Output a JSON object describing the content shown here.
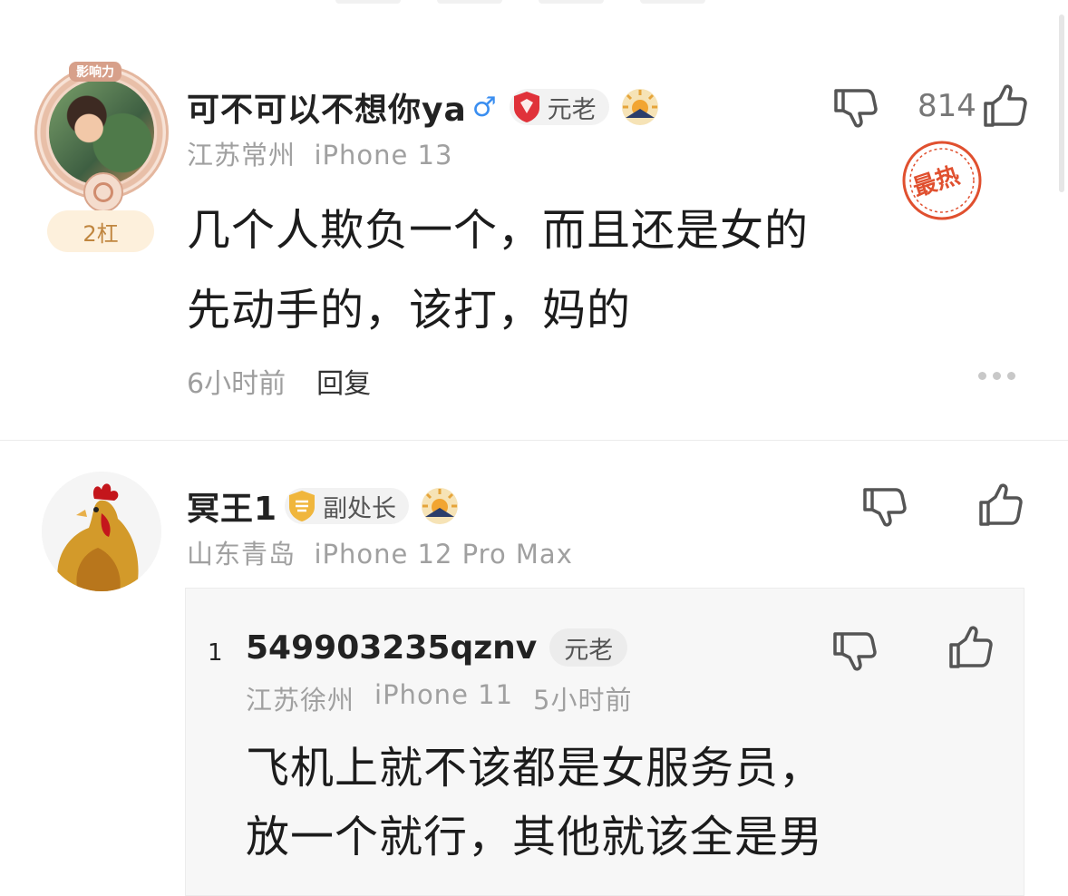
{
  "comments": [
    {
      "user": "可不可以不想你ya",
      "frame_label": "影响力",
      "gang_badge": "2杠",
      "rank": "元老",
      "location": "江苏常州",
      "device": "iPhone 13",
      "text_lines": [
        "几个人欺负一个，而且还是女的",
        "先动手的，该打，妈的"
      ],
      "time": "6小时前",
      "reply_label": "回复",
      "likes": "814",
      "hot_stamp": "最热",
      "gender": "male"
    },
    {
      "user": "冥王1",
      "rank": "副处长",
      "location": "山东青岛",
      "device": "iPhone 12 Pro Max",
      "nested_reply": {
        "index": "1",
        "user": "549903235qznv",
        "rank": "元老",
        "location": "江苏徐州",
        "device": "iPhone 11",
        "time": "5小时前",
        "text_lines": [
          "飞机上就不该都是女服务员，",
          "放一个就行，其他就该全是男"
        ]
      }
    }
  ],
  "icons": {
    "dislike": "thumb-down-icon",
    "like": "thumb-up-icon",
    "more": "more-dots-icon"
  },
  "colors": {
    "gender": "#3a8ef0",
    "stamp": "#e0502f",
    "meta_text": "#a0a0a0",
    "badge_bg": "#fdf0dc"
  }
}
